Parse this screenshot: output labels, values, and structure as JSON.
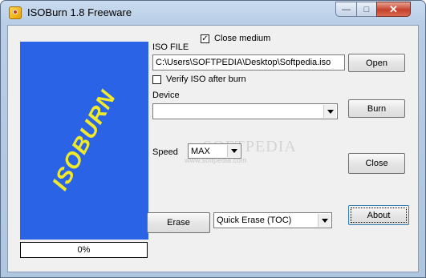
{
  "window": {
    "title": "ISOBurn 1.8 Freeware"
  },
  "logo": {
    "text": "ISOBURN",
    "color": "#f0ea2a",
    "background": "#2b63e6"
  },
  "progress": {
    "text": "0%",
    "value": 0
  },
  "iso": {
    "label": "ISO FILE",
    "close_medium_label": "Close medium",
    "close_medium_checked": true,
    "path": "C:\\Users\\SOFTPEDIA\\Desktop\\Softpedia.iso",
    "verify_label": "Verify ISO after burn",
    "verify_checked": false
  },
  "device": {
    "label": "Device",
    "value": ""
  },
  "speed": {
    "label": "Speed",
    "value": "MAX"
  },
  "erase": {
    "mode": "Quick Erase (TOC)"
  },
  "buttons": {
    "open": "Open",
    "burn": "Burn",
    "close": "Close",
    "erase": "Erase",
    "about": "About"
  },
  "watermark": {
    "text": "SOFTPEDIA",
    "url": "www.softpedia.com"
  },
  "icons": {
    "app": "disc-burn-icon",
    "minimize": "minimize-icon",
    "maximize": "maximize-icon",
    "close": "close-icon"
  }
}
